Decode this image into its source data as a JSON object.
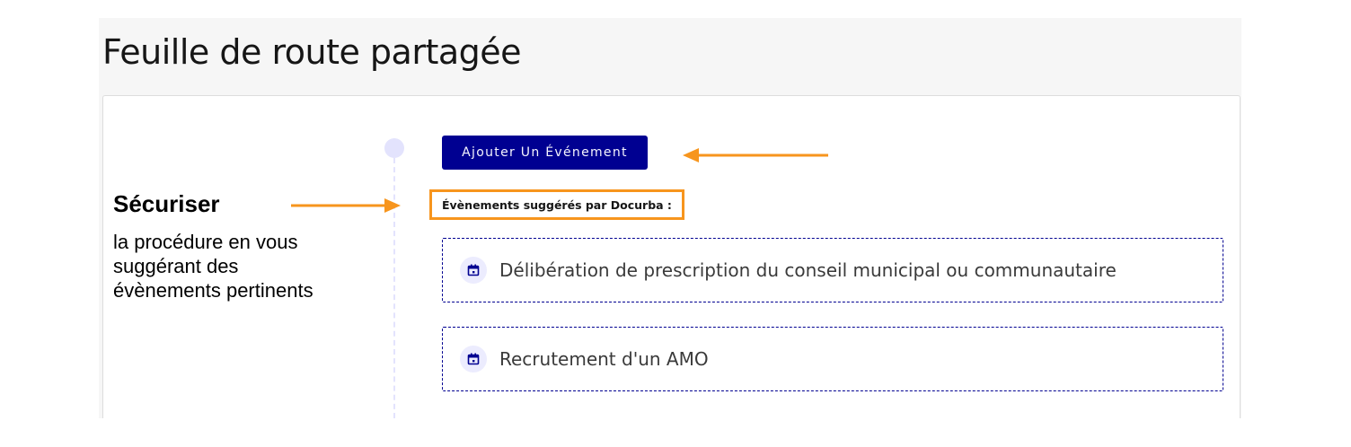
{
  "page": {
    "title": "Feuille de route partagée"
  },
  "toolbar": {
    "add_event_label": "Ajouter Un Événement"
  },
  "suggestions": {
    "title": "Évènements suggérés par Docurba :",
    "items": [
      {
        "label": "Délibération de prescription du conseil municipal ou communautaire",
        "icon": "calendar-icon"
      },
      {
        "label": "Recrutement d'un AMO",
        "icon": "calendar-icon"
      }
    ]
  },
  "annotation": {
    "heading": "Sécuriser",
    "lines": [
      "la procédure en vous",
      "suggérant des",
      "évènements pertinents"
    ]
  },
  "colors": {
    "primary": "#000091",
    "accent_arrow": "#f7951d",
    "timeline": "#e3e3fd",
    "icon_bg": "#ececfe"
  }
}
